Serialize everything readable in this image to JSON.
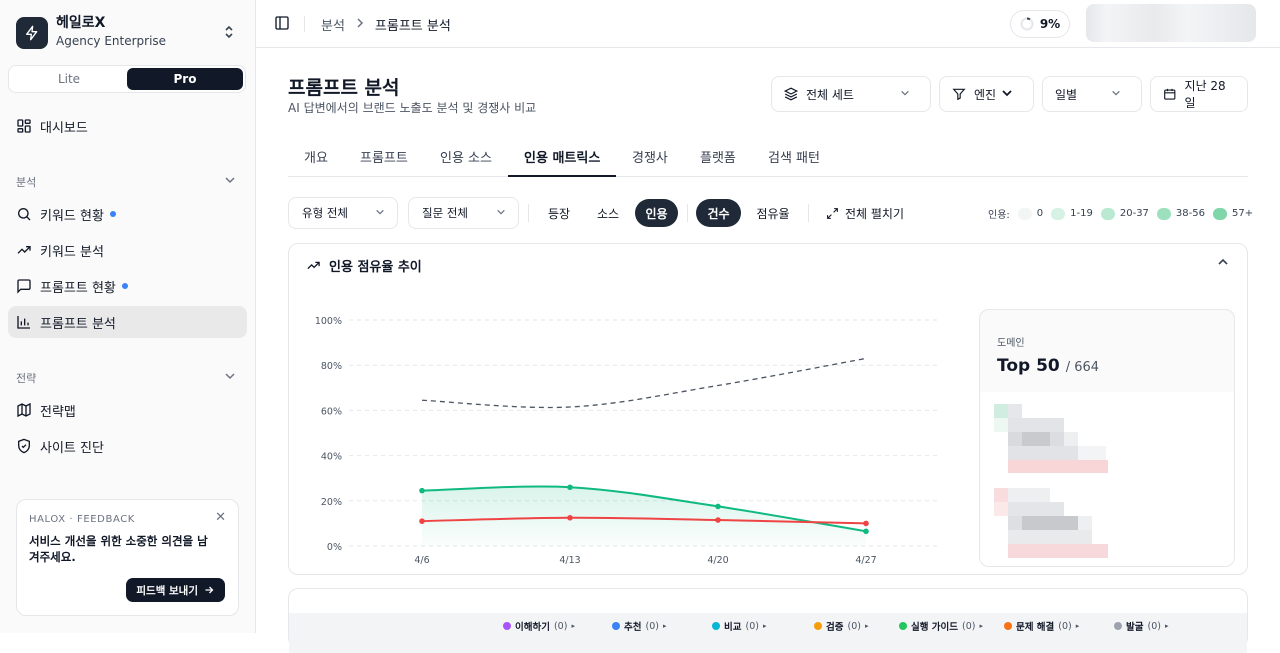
{
  "sidebar": {
    "brand_name": "헤일로X",
    "brand_sub": "Agency Enterprise",
    "plans": [
      "Lite",
      "Pro"
    ],
    "active_plan": "Pro",
    "dashboard": "대시보드",
    "section_analysis": "분석",
    "analysis_items": [
      {
        "label": "키워드 현황",
        "icon": "search-icon",
        "dot": true
      },
      {
        "label": "키워드 분석",
        "icon": "trending-up-icon",
        "dot": false
      },
      {
        "label": "프롬프트 현황",
        "icon": "message-icon",
        "dot": true
      },
      {
        "label": "프롬프트 분석",
        "icon": "bar-chart-icon",
        "dot": false,
        "active": true
      }
    ],
    "section_strategy": "전략",
    "strategy_items": [
      {
        "label": "전략맵",
        "icon": "map-icon"
      },
      {
        "label": "사이트 진단",
        "icon": "shield-icon"
      }
    ],
    "feedback": {
      "kicker": "HALOX · FEEDBACK",
      "title": "서비스 개선을 위한 소중한 의견을 남겨주세요.",
      "button": "피드백 보내기"
    }
  },
  "topbar": {
    "breadcrumb": [
      "분석",
      "프롬프트 분석"
    ],
    "progress": "9%",
    "progress_value": 0.09
  },
  "header": {
    "title": "프롬프트 분석",
    "subtitle": "AI 답변에서의 브랜드 노출도 분석 및 경쟁사 비교",
    "filters": {
      "set": "전체 세트",
      "engine": "엔진",
      "period": "일별",
      "range": "지난 28일"
    }
  },
  "tabs": [
    "개요",
    "프롬프트",
    "인용 소스",
    "인용 매트릭스",
    "경쟁사",
    "플랫폼",
    "검색 패턴"
  ],
  "active_tab": "인용 매트릭스",
  "toolbar": {
    "type_select": "유형 전체",
    "question_select": "질문 전체",
    "view_chips": [
      "등장",
      "소스",
      "인용"
    ],
    "active_view": "인용",
    "metric_chips": [
      "건수",
      "점유율"
    ],
    "active_metric": "건수",
    "expand_all": "전체 펼치기",
    "scale_label": "인용:",
    "scale": [
      {
        "label": "0",
        "color": "#f1f5f3"
      },
      {
        "label": "1-19",
        "color": "#d6f2e4"
      },
      {
        "label": "20-37",
        "color": "#b9e9d1"
      },
      {
        "label": "38-56",
        "color": "#9de0bd"
      },
      {
        "label": "57+",
        "color": "#7fd6a8"
      }
    ]
  },
  "trend_card": {
    "title": "인용 점유율 추이"
  },
  "chart_data": {
    "type": "line",
    "x": [
      "4/6",
      "4/13",
      "4/20",
      "4/27"
    ],
    "ylim": [
      0,
      100
    ],
    "y_ticks": [
      "0%",
      "20%",
      "40%",
      "60%",
      "80%",
      "100%"
    ],
    "grid": true,
    "series": [
      {
        "style": "dashed",
        "color": "#4b5563",
        "values": [
          64.5,
          61.5,
          71,
          83
        ]
      },
      {
        "style": "solid-area",
        "color": "#10b981",
        "values": [
          24.5,
          26,
          17.5,
          6.5
        ]
      },
      {
        "style": "solid",
        "color": "#ef4444",
        "values": [
          11,
          12.5,
          11.5,
          10
        ]
      }
    ]
  },
  "domain_panel": {
    "label": "도메인",
    "top": "Top 50",
    "total": "/ 664"
  },
  "categories": [
    {
      "label": "이해하기",
      "count": "(0)",
      "color": "#a855f7"
    },
    {
      "label": "추천",
      "count": "(0)",
      "color": "#3b82f6"
    },
    {
      "label": "비교",
      "count": "(0)",
      "color": "#06b6d4"
    },
    {
      "label": "검증",
      "count": "(0)",
      "color": "#f59e0b"
    },
    {
      "label": "실행 가이드",
      "count": "(0)",
      "color": "#22c55e"
    },
    {
      "label": "문제 해결",
      "count": "(0)",
      "color": "#f97316"
    },
    {
      "label": "발굴",
      "count": "(0)",
      "color": "#9ca3af"
    }
  ]
}
